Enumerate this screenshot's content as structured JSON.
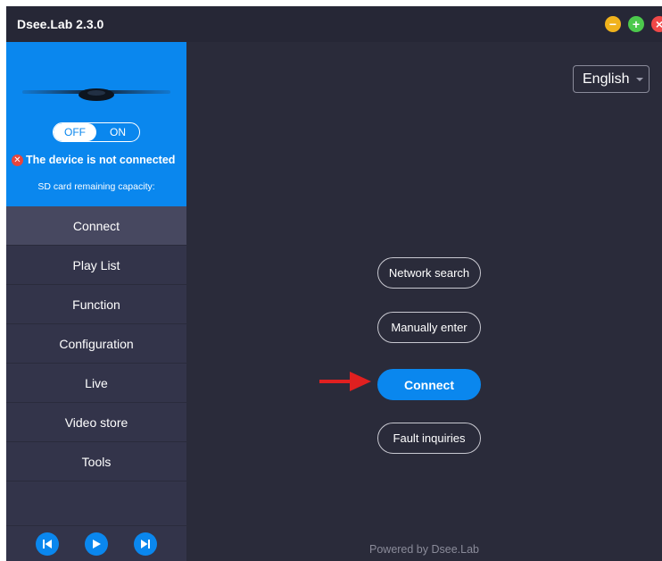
{
  "window": {
    "title": "Dsee.Lab 2.3.0",
    "controls": {
      "minimize": "−",
      "maximize": "+",
      "close": "×"
    }
  },
  "device": {
    "toggle_off": "OFF",
    "toggle_on": "ON",
    "toggle_state": "OFF",
    "status": "The device is not connected",
    "sd_capacity": "SD card remaining capacity:"
  },
  "nav": {
    "items": [
      {
        "label": "Connect",
        "active": true
      },
      {
        "label": "Play List"
      },
      {
        "label": "Function"
      },
      {
        "label": "Configuration"
      },
      {
        "label": "Live"
      },
      {
        "label": "Video store"
      },
      {
        "label": "Tools"
      }
    ]
  },
  "main": {
    "language": "English",
    "buttons": {
      "network_search": "Network search",
      "manually_enter": "Manually enter",
      "connect": "Connect",
      "fault_inquiries": "Fault inquiries"
    },
    "footer": "Powered by Dsee.Lab"
  },
  "colors": {
    "accent": "#0a87ee",
    "background": "#2a2b3a",
    "sidebar": "#33344a",
    "error": "#e8453c",
    "annotation_arrow": "#e02020"
  },
  "icons": {
    "media": [
      "skip-previous-icon",
      "play-icon",
      "skip-next-icon"
    ]
  }
}
